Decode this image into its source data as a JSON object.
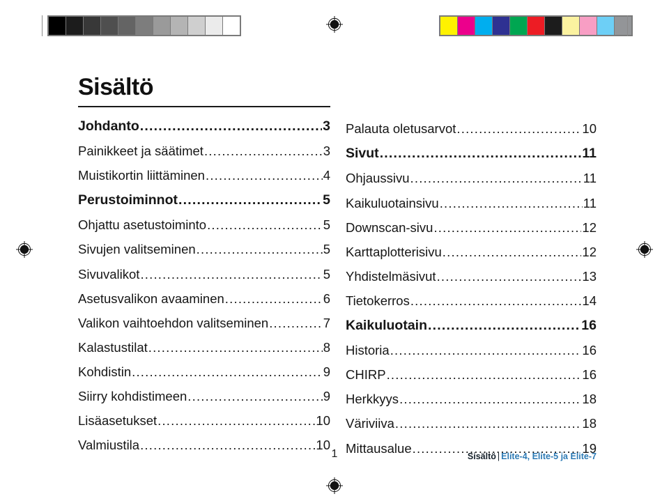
{
  "document": {
    "title": "Sisältö",
    "page_number": "1"
  },
  "print_marks": {
    "grayscale_label": "grayscale-calibration-strip",
    "color_label": "color-calibration-strip",
    "grayscale_swatches": [
      "#000000",
      "#1c1c1c",
      "#383838",
      "#4f4f4f",
      "#646464",
      "#7d7d7d",
      "#9a9a9a",
      "#b4b4b4",
      "#cfcfcf",
      "#ebebeb",
      "#ffffff"
    ],
    "color_swatches": [
      "#fff200",
      "#ec008c",
      "#00aeef",
      "#2e3192",
      "#00a651",
      "#ed1c24",
      "#1c1c1c",
      "#fbf2a0",
      "#f89ec4",
      "#6dcff6",
      "#939598"
    ]
  },
  "toc": {
    "left_column": [
      {
        "label": "Johdanto",
        "page": "3",
        "level": 1
      },
      {
        "label": "Painikkeet ja säätimet",
        "page": "3",
        "level": 2
      },
      {
        "label": "Muistikortin liittäminen",
        "page": "4",
        "level": 2
      },
      {
        "label": "Perustoiminnot",
        "page": "5",
        "level": 1
      },
      {
        "label": "Ohjattu asetustoiminto",
        "page": "5",
        "level": 2
      },
      {
        "label": "Sivujen valitseminen",
        "page": "5",
        "level": 2
      },
      {
        "label": "Sivuvalikot",
        "page": "5",
        "level": 2
      },
      {
        "label": "Asetusvalikon avaaminen",
        "page": "6",
        "level": 2
      },
      {
        "label": "Valikon vaihtoehdon valitseminen",
        "page": "7",
        "level": 2
      },
      {
        "label": "Kalastustilat",
        "page": "8",
        "level": 2
      },
      {
        "label": "Kohdistin",
        "page": "9",
        "level": 2
      },
      {
        "label": "Siirry kohdistimeen",
        "page": "9",
        "level": 2
      },
      {
        "label": "Lisäasetukset",
        "page": "10",
        "level": 2
      },
      {
        "label": "Valmiustila",
        "page": "10",
        "level": 2
      }
    ],
    "right_column": [
      {
        "label": "Palauta oletusarvot",
        "page": "10",
        "level": 2
      },
      {
        "label": "Sivut",
        "page": "11",
        "level": 1
      },
      {
        "label": "Ohjaussivu",
        "page": "11",
        "level": 2
      },
      {
        "label": "Kaikuluotainsivu",
        "page": "11",
        "level": 2
      },
      {
        "label": "Downscan-sivu",
        "page": "12",
        "level": 2
      },
      {
        "label": "Karttaplotterisivu",
        "page": "12",
        "level": 2
      },
      {
        "label": "Yhdistelmäsivut",
        "page": "13",
        "level": 2
      },
      {
        "label": "Tietokerros",
        "page": "14",
        "level": 2
      },
      {
        "label": "Kaikuluotain",
        "page": "16",
        "level": 1
      },
      {
        "label": "Historia",
        "page": "16",
        "level": 2
      },
      {
        "label": "CHIRP",
        "page": "16",
        "level": 2
      },
      {
        "label": "Herkkyys",
        "page": "18",
        "level": 2
      },
      {
        "label": "Väriviiva",
        "page": "18",
        "level": 2
      },
      {
        "label": "Mittausalue",
        "page": "19",
        "level": 2
      }
    ]
  },
  "footer": {
    "section": "Sisältö",
    "separator": "|",
    "products": "Elite-4, Elite-5 ja Elite-7",
    "product_color": "#2e7bb5"
  }
}
